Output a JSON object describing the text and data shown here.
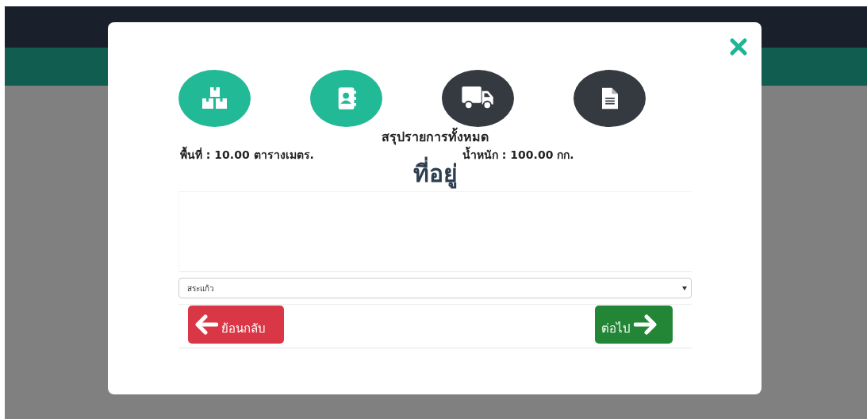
{
  "steps": [
    {
      "kind": "boxes",
      "completed": true
    },
    {
      "kind": "contacts",
      "completed": true
    },
    {
      "kind": "truck",
      "completed": false
    },
    {
      "kind": "document",
      "completed": false
    }
  ],
  "summary": {
    "title": "สรุปรายการทั้งหมด",
    "area": "พื้นที่ : 10.00 ตารางเมตร.",
    "weight": "น้ำหนัก : 100.00 กก."
  },
  "address": {
    "heading": "ที่อยู่",
    "province": "สระแก้ว"
  },
  "buttons": {
    "back": "ย้อนกลับ",
    "next": "ต่อไป"
  }
}
